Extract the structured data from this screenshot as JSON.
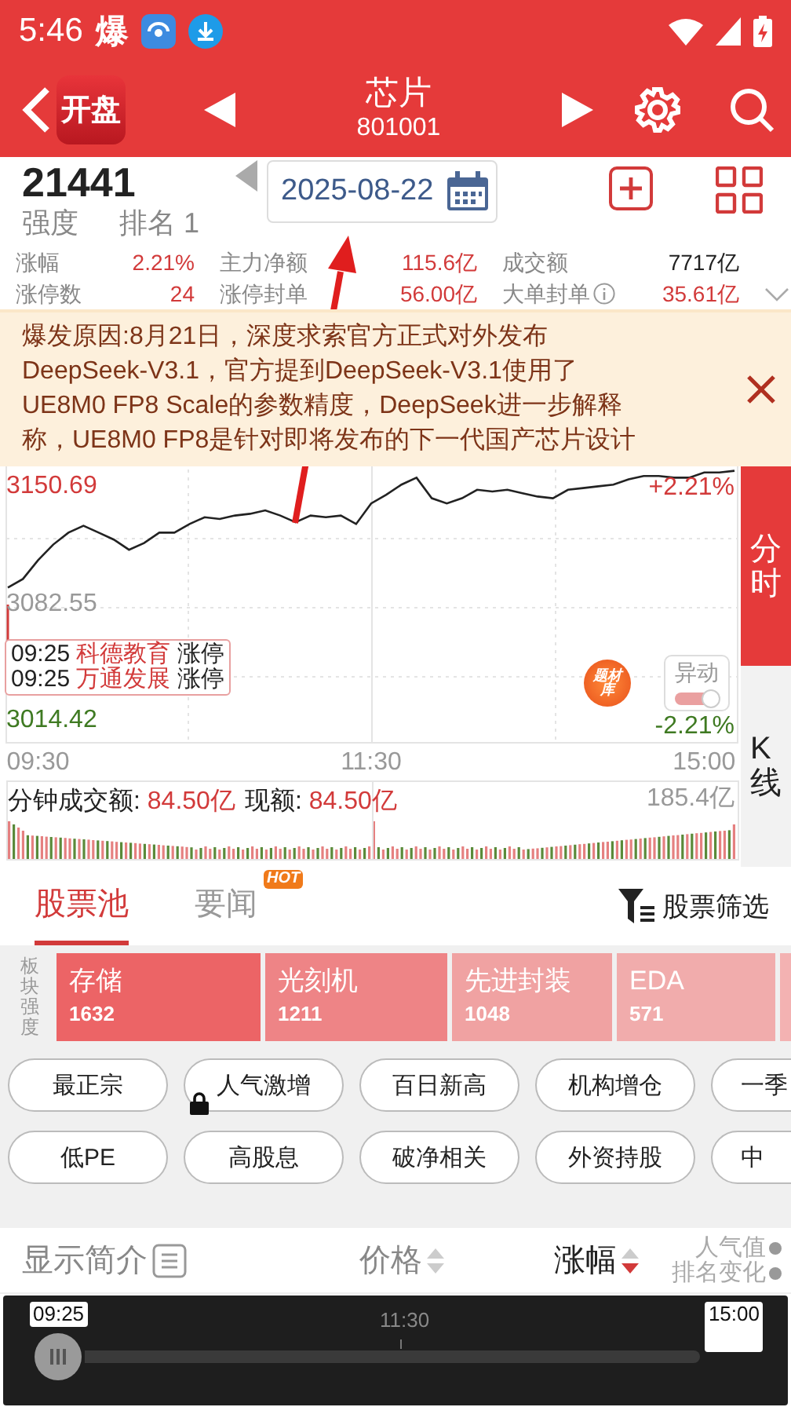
{
  "status_bar": {
    "time": "5:46",
    "notification": "爆"
  },
  "header": {
    "logo": "开盘",
    "title": "芯片",
    "code": "801001"
  },
  "summary": {
    "strength": "21441",
    "strength_label": "强度",
    "rank_label": "排名",
    "rank": "1",
    "date": "2025-08-22",
    "stats": [
      {
        "label": "涨幅",
        "value": "2.21%",
        "up": true,
        "info": false
      },
      {
        "label": "主力净额",
        "value": "115.6亿",
        "up": true,
        "info": false
      },
      {
        "label": "成交额",
        "value": "7717亿",
        "up": false,
        "info": false
      },
      {
        "label": "涨停数",
        "value": "24",
        "up": true,
        "info": false
      },
      {
        "label": "涨停封单",
        "value": "56.00亿",
        "up": true,
        "info": false
      },
      {
        "label": "大单封单",
        "value": "35.61亿",
        "up": true,
        "info": true
      }
    ],
    "expanded": false
  },
  "banner": {
    "lines": [
      "爆发原因:8月21日，深度求索官方正式对外发布",
      "DeepSeek-V3.1，官方提到DeepSeek-V3.1使用了",
      "UE8M0 FP8 Scale的参数精度，DeepSeek进一步解释",
      "称，UE8M0 FP8是针对即将发布的下一代国产芯片设计"
    ]
  },
  "chart": {
    "pct_high": "+2.21%",
    "pct_low": "-2.21%",
    "chart_data": {
      "type": "line",
      "categories": [
        null,
        null,
        "09:30",
        null,
        null,
        null,
        null,
        null,
        null,
        null,
        null,
        null,
        null,
        null,
        null,
        null,
        null,
        null,
        null,
        null,
        null,
        null,
        null,
        null,
        "11:30",
        null,
        null,
        null,
        null,
        null,
        null,
        null,
        null,
        null,
        null,
        null,
        null,
        null,
        null,
        null,
        null,
        null,
        null,
        null,
        null,
        null,
        "15:00",
        null,
        null
      ],
      "series": [
        {
          "color": "#222222",
          "values": [
            3092,
            3097,
            3108,
            3117,
            3124,
            3128,
            3124,
            3120,
            3114,
            3118,
            3124,
            3124,
            3129,
            3133,
            3132,
            3134,
            3135,
            3137,
            3134,
            3130,
            3134,
            3133,
            3134,
            3129,
            3141,
            3146,
            3152,
            3156,
            3144,
            3141,
            3144,
            3149,
            3148,
            3149,
            3147,
            3145,
            3144,
            3149,
            3150,
            3151,
            3152,
            3155,
            3157,
            3157,
            3156,
            3156,
            3159,
            3159,
            3160
          ]
        }
      ],
      "ylim": [
        3001.6,
        3162.6
      ],
      "yticks": [
        {
          "value": 3150.69,
          "label": "3150.69"
        },
        {
          "value": 3082.55,
          "label": "3082.55"
        },
        {
          "value": 3014.42,
          "label": "3014.42"
        }
      ]
    },
    "events": [
      {
        "time": "09:25",
        "name": "科德教育",
        "status": "涨停"
      },
      {
        "time": "09:25",
        "name": "万通发展",
        "status": "涨停"
      }
    ],
    "badge": "题材库",
    "alert_toggle": {
      "label": "异动",
      "on": true
    },
    "volume_label": "分钟成交额:",
    "volume_value": "84.50亿",
    "current_label": "现额:",
    "current_value": "84.50亿",
    "volume_max": "185.4亿"
  },
  "view_tabs": [
    {
      "label": "分时",
      "selected": true
    },
    {
      "label": "K线",
      "selected": false
    }
  ],
  "section_tabs": [
    {
      "label": "股票池",
      "selected": true
    },
    {
      "label": "要闻",
      "selected": false,
      "badge": "HOT"
    }
  ],
  "filter_button": "股票筛选",
  "sector_strength": {
    "label": "板块强度",
    "sectors": [
      {
        "name": "存储",
        "value": "1632",
        "color": "#ec6466"
      },
      {
        "name": "光刻机",
        "value": "1211",
        "color": "#ee8486"
      },
      {
        "name": "先进封装",
        "value": "1048",
        "color": "#f0a2a2"
      },
      {
        "name": "EDA",
        "value": "571",
        "color": "#f1acac"
      }
    ]
  },
  "filter_rows": [
    {
      "chips": [
        {
          "label": "最正宗",
          "locked": false
        },
        {
          "label": "人气激增",
          "locked": true
        },
        {
          "label": "百日新高",
          "locked": false
        },
        {
          "label": "机构增仓",
          "locked": false
        },
        {
          "label": "一季",
          "locked": false
        }
      ]
    },
    {
      "chips": [
        {
          "label": "低PE",
          "locked": false
        },
        {
          "label": "高股息",
          "locked": false
        },
        {
          "label": "破净相关",
          "locked": false
        },
        {
          "label": "外资持股",
          "locked": false
        },
        {
          "label": "中",
          "locked": false
        }
      ]
    }
  ],
  "columns": [
    {
      "kind": "toggle",
      "lines": [
        "显示简介"
      ]
    },
    {
      "kind": "sort",
      "lines": [
        "价格"
      ],
      "sort_desc": false
    },
    {
      "kind": "sort",
      "lines": [
        "涨幅"
      ],
      "sort_desc": true
    },
    {
      "kind": "stack",
      "lines": [
        "人气值",
        "排名变化"
      ]
    }
  ],
  "replay": {
    "start": "09:25",
    "mid": "11:30",
    "end": "15:00"
  },
  "annotation": {
    "kind": "arrow"
  }
}
